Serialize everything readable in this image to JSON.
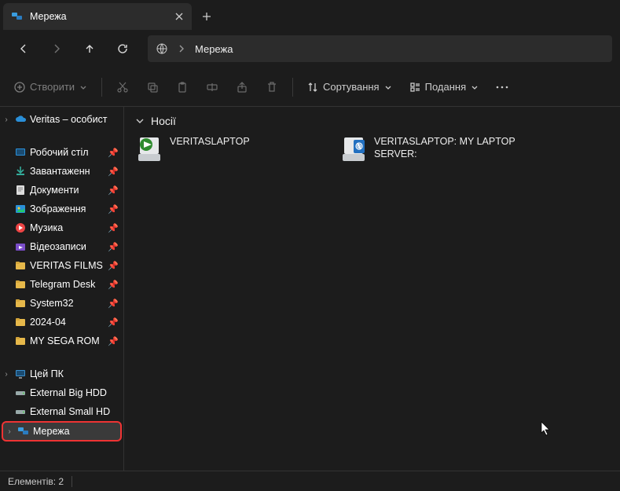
{
  "tab": {
    "title": "Мережа"
  },
  "breadcrumb": {
    "label": "Мережа"
  },
  "toolbar": {
    "create": "Створити",
    "sort": "Сортування",
    "view": "Подання"
  },
  "sidebar": {
    "onedrive": "Veritas – особист",
    "pinned": [
      "Робочий стіл",
      "Завантаженн",
      "Документи",
      "Зображення",
      "Музика",
      "Відеозаписи",
      "VERITAS FILMS",
      "Telegram Desk",
      "System32",
      "2024-04",
      "MY SEGA ROM"
    ],
    "thispc": "Цей ПК",
    "drives": [
      "External Big HDD",
      "External Small HD"
    ],
    "network": "Мережа"
  },
  "section": {
    "header": "Носії"
  },
  "hosts": [
    {
      "name": "VERITASLAPTOP"
    },
    {
      "name": "VERITASLAPTOP: MY LAPTOP SERVER:"
    }
  ],
  "status": {
    "items": "Елементів: 2"
  }
}
